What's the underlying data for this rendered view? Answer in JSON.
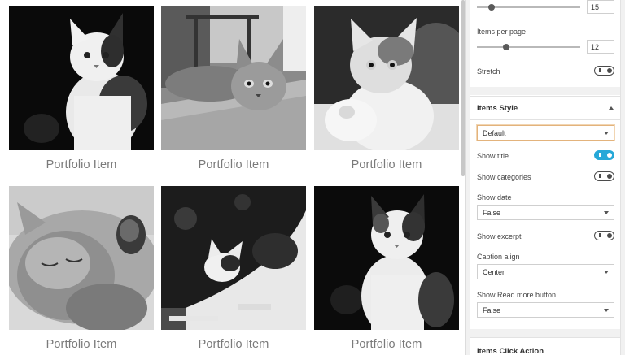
{
  "portfolio": {
    "items": [
      {
        "title": "Portfolio Item",
        "image": "cat-black-bg-sitting"
      },
      {
        "title": "Portfolio Item",
        "image": "tabby-cat-lying-on-rug"
      },
      {
        "title": "Portfolio Item",
        "image": "kitten-raising-paw"
      },
      {
        "title": "Portfolio Item",
        "image": "cat-sleeping-paw-up"
      },
      {
        "title": "Portfolio Item",
        "image": "cat-stretching"
      },
      {
        "title": "Portfolio Item",
        "image": "kitten-sitting-black-bg"
      }
    ]
  },
  "panel": {
    "top_slider_value": "15",
    "items_per_page_label": "Items per page",
    "items_per_page_value": "12",
    "stretch_label": "Stretch",
    "items_style_header": "Items Style",
    "style_select_value": "Default",
    "show_title_label": "Show title",
    "show_categories_label": "Show categories",
    "show_date_label": "Show date",
    "show_date_value": "False",
    "show_excerpt_label": "Show excerpt",
    "caption_align_label": "Caption align",
    "caption_align_value": "Center",
    "show_read_more_label": "Show Read more button",
    "show_read_more_value": "False",
    "items_click_action_header": "Items Click Action"
  },
  "toggles": {
    "stretch": false,
    "show_title": true,
    "show_categories": false,
    "show_excerpt": false
  },
  "slider_levels": {
    "top_slider_fraction": 0.14,
    "items_per_page_fraction": 0.27
  },
  "colors": {
    "accent": "#26a8d8",
    "focus_border": "#e3b37c"
  }
}
